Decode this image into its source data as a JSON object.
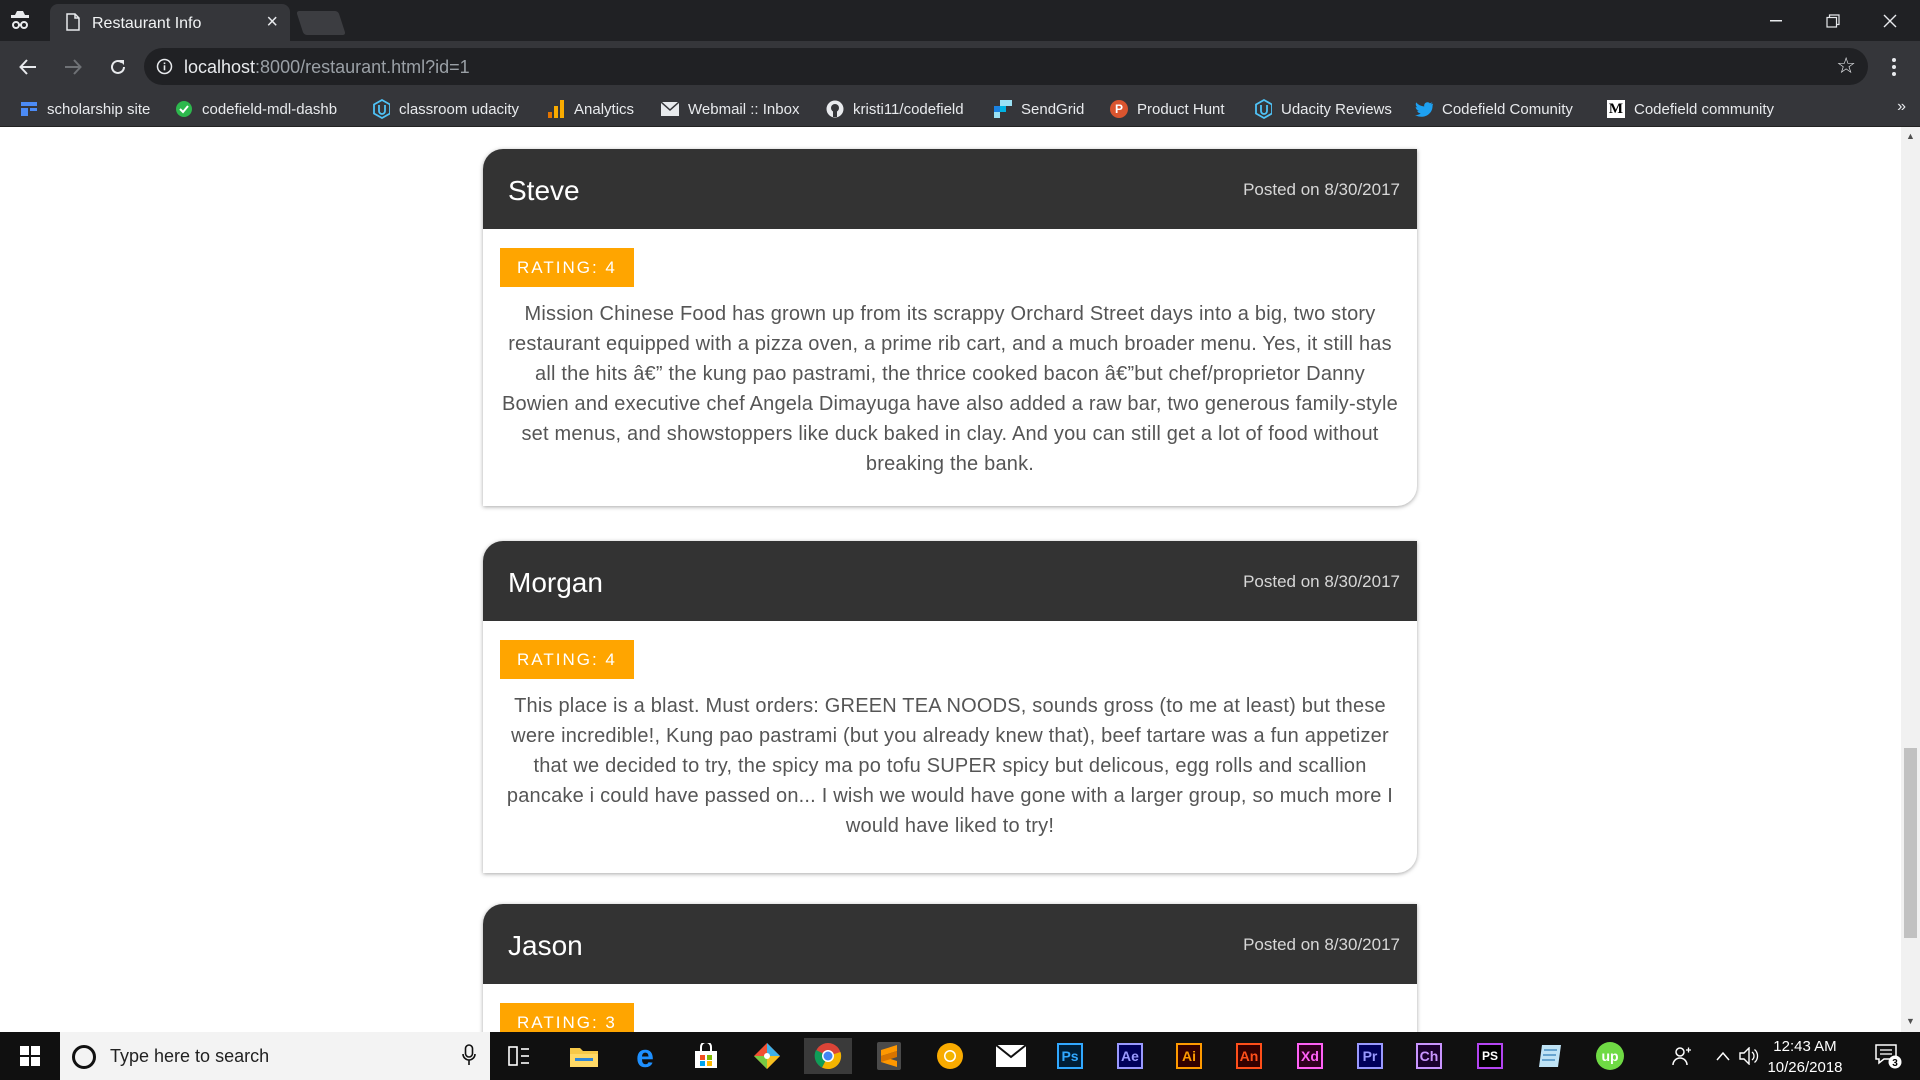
{
  "browser": {
    "tab_title": "Restaurant Info",
    "url_host": "localhost",
    "url_rest": ":8000/restaurant.html?id=1"
  },
  "bookmarks": [
    {
      "label": "scholarship site",
      "icon": "bookmark-blue-icon",
      "color": "#4c8bf5"
    },
    {
      "label": "codefield-mdl-dashb",
      "icon": "green-check-icon",
      "color": "#2db84d"
    },
    {
      "label": "classroom udacity",
      "icon": "udacity-icon",
      "color": "#4fc3f7"
    },
    {
      "label": "Analytics",
      "icon": "analytics-icon",
      "color": "#f9ab00"
    },
    {
      "label": "Webmail :: Inbox",
      "icon": "mail-icon",
      "color": "#e8eaed"
    },
    {
      "label": "kristi11/codefield",
      "icon": "github-icon",
      "color": "#e8eaed"
    },
    {
      "label": "SendGrid",
      "icon": "sendgrid-icon",
      "color": "#1a82e2"
    },
    {
      "label": "Product Hunt",
      "icon": "product-hunt-icon",
      "color": "#da552f"
    },
    {
      "label": "Udacity Reviews",
      "icon": "udacity-icon",
      "color": "#4fc3f7"
    },
    {
      "label": "Codefield Comunity",
      "icon": "twitter-icon",
      "color": "#1da1f2"
    },
    {
      "label": "Codefield community",
      "icon": "medium-icon",
      "color": "#ffffff"
    }
  ],
  "reviews": [
    {
      "name": "Steve",
      "date": "Posted on 8/30/2017",
      "rating": "RATING: 4",
      "comments": "Mission Chinese Food has grown up from its scrappy Orchard Street days into a big, two story restaurant equipped with a pizza oven, a prime rib cart, and a much broader menu. Yes, it still has all the hits â€” the kung pao pastrami, the thrice cooked bacon â€”but chef/proprietor Danny Bowien and executive chef Angela Dimayuga have also added a raw bar, two generous family-style set menus, and showstoppers like duck baked in clay. And you can still get a lot of food without breaking the bank."
    },
    {
      "name": "Morgan",
      "date": "Posted on 8/30/2017",
      "rating": "RATING: 4",
      "comments": "This place is a blast. Must orders: GREEN TEA NOODS, sounds gross (to me at least) but these were incredible!, Kung pao pastrami (but you already knew that), beef tartare was a fun appetizer that we decided to try, the spicy ma po tofu SUPER spicy but delicous, egg rolls and scallion pancake i could have passed on... I wish we would have gone with a larger group, so much more I would have liked to try!"
    },
    {
      "name": "Jason",
      "date": "Posted on 8/30/2017",
      "rating": "RATING: 3",
      "comments": ""
    }
  ],
  "taskbar": {
    "search_placeholder": "Type here to search",
    "time": "12:43 AM",
    "date": "10/26/2018",
    "notifications": "3",
    "apps": [
      {
        "name": "task-view-icon",
        "label": ""
      },
      {
        "name": "file-explorer-icon",
        "label": ""
      },
      {
        "name": "edge-icon",
        "label": ""
      },
      {
        "name": "store-icon",
        "label": ""
      },
      {
        "name": "git-icon",
        "label": ""
      },
      {
        "name": "chrome-icon",
        "label": ""
      },
      {
        "name": "sublime-icon",
        "label": ""
      },
      {
        "name": "canary-icon",
        "label": ""
      },
      {
        "name": "mail-icon",
        "label": ""
      },
      {
        "name": "photoshop-icon",
        "label": "Ps",
        "color": "#31a8ff"
      },
      {
        "name": "after-effects-icon",
        "label": "Ae",
        "color": "#9999ff"
      },
      {
        "name": "illustrator-icon",
        "label": "Ai",
        "color": "#ff9a00"
      },
      {
        "name": "animate-icon",
        "label": "An",
        "color": "#ff4f1a"
      },
      {
        "name": "xd-icon",
        "label": "Xd",
        "color": "#ff61f6"
      },
      {
        "name": "premiere-icon",
        "label": "Pr",
        "color": "#9999ff"
      },
      {
        "name": "character-animator-icon",
        "label": "Ch",
        "color": "#c995ff"
      },
      {
        "name": "phpstorm-icon",
        "label": "PS",
        "color": "#ffffff"
      },
      {
        "name": "notes-icon",
        "label": ""
      },
      {
        "name": "upwork-icon",
        "label": "up",
        "color": "#6fda44"
      }
    ]
  }
}
